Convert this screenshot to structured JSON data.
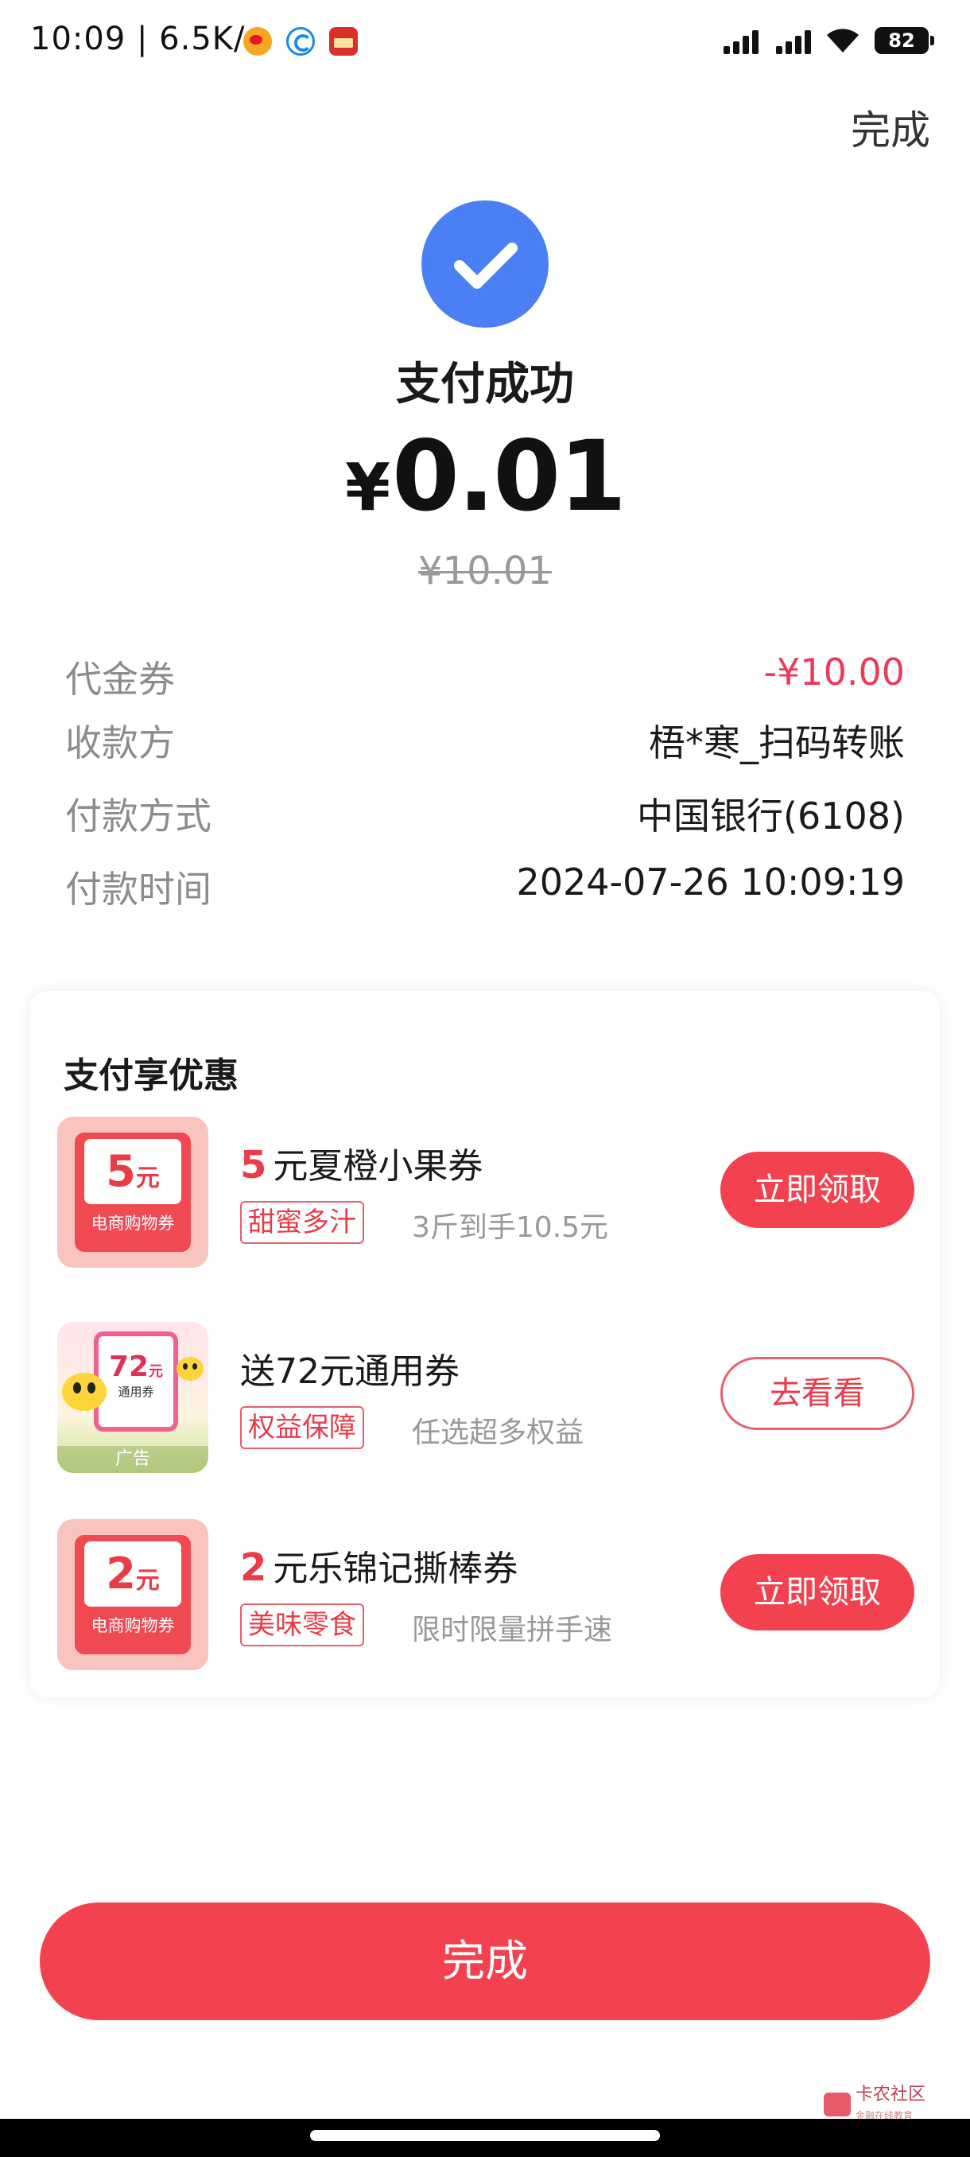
{
  "status_bar": {
    "time_speed": "10:09 | 6.5K/s",
    "battery": "82",
    "icons": [
      "weibo-icon",
      "telecom-icon",
      "app-icon",
      "signal-icon",
      "signal-icon",
      "wifi-icon",
      "battery-icon"
    ]
  },
  "header": {
    "done_label": "完成"
  },
  "result": {
    "title": "支付成功",
    "currency": "¥",
    "amount": "0.01",
    "original_amount": "¥10.01",
    "icon": "check-circle-icon",
    "icon_color": "#4a80f4"
  },
  "details": [
    {
      "label": "代金券",
      "value": "-¥10.00",
      "highlight": true
    },
    {
      "label": "收款方",
      "value": "梧*寒_扫码转账"
    },
    {
      "label": "付款方式",
      "value": "中国银行(6108)"
    },
    {
      "label": "付款时间",
      "value": "2024-07-26 10:09:19"
    }
  ],
  "promo": {
    "title": "支付享优惠",
    "offers": [
      {
        "thumb": {
          "value": "5",
          "unit": "元",
          "label": "电商购物券"
        },
        "title_num": "5",
        "title_text": "元夏橙小果券",
        "tag": "甜蜜多汁",
        "desc": "3斤到手10.5元",
        "button": "立即领取"
      },
      {
        "thumb": {
          "value": "72",
          "unit": "元",
          "sub": "通用券",
          "ad_label": "广告"
        },
        "title_num": "",
        "title_text": "送72元通用券",
        "tag": "权益保障",
        "desc": "任选超多权益",
        "button": "去看看"
      },
      {
        "thumb": {
          "value": "2",
          "unit": "元",
          "label": "电商购物券"
        },
        "title_num": "2",
        "title_text": "元乐锦记撕棒券",
        "tag": "美味零食",
        "desc": "限时限量拼手速",
        "button": "立即领取"
      }
    ]
  },
  "footer": {
    "done_label": "完成"
  },
  "watermark": {
    "text": "卡农社区",
    "sub": "金融在线教育"
  },
  "colors": {
    "accent": "#f2424f",
    "brand_blue": "#4a80f4",
    "discount_red": "#ee3b55"
  }
}
